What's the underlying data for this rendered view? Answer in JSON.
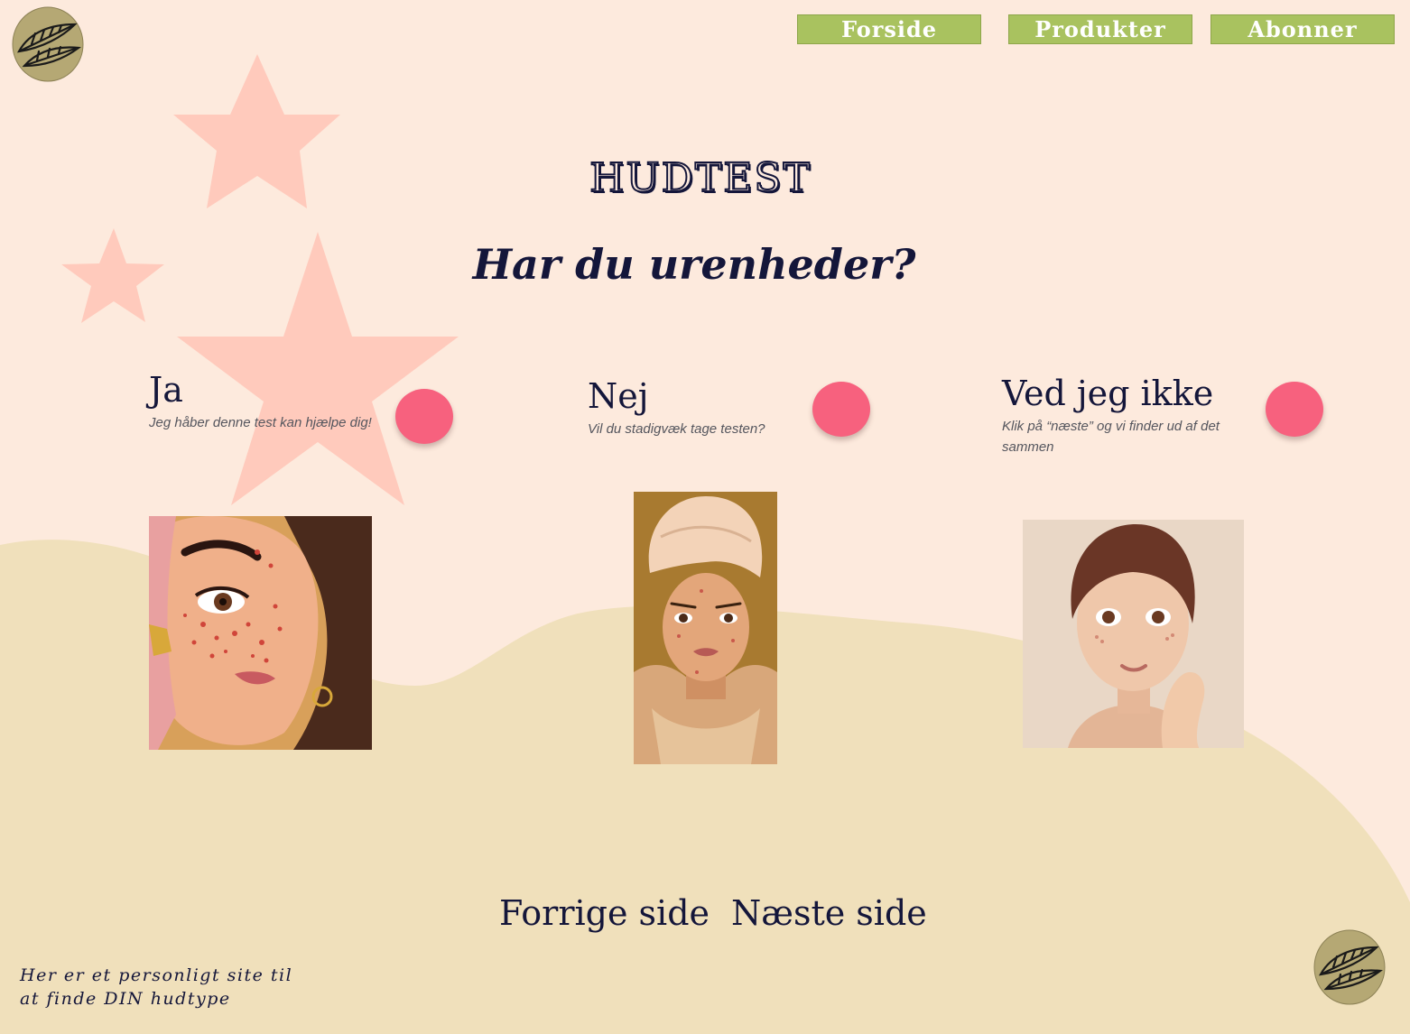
{
  "colors": {
    "background": "#fdeadd",
    "wave": "#f0e0bb",
    "star": "#ffcabc",
    "nav_button": "#a9c25f",
    "radio": "#f7617e",
    "text": "#14163a"
  },
  "nav": {
    "items": [
      "Forside",
      "Produkter",
      "Abonner"
    ]
  },
  "logo_icon": "feather-leaf-logo",
  "page_title": "HUDTEST",
  "question": "Har du urenheder?",
  "options": [
    {
      "title": "Ja",
      "subtitle": "Jeg håber denne test kan hjælpe dig!",
      "image": "woman-with-acne-mirror-illustration"
    },
    {
      "title": "Nej",
      "subtitle": "Vil du stadigvæk tage testen?",
      "image": "woman-in-towel-turban-illustration"
    },
    {
      "title": "Ved jeg ikke",
      "subtitle": "Klik på “næste” og vi finder ud af det sammen",
      "image": "woman-touching-face-illustration"
    }
  ],
  "pager": {
    "prev": "Forrige side",
    "next": "Næste side"
  },
  "footer_note": "Her er et personligt site til\nat finde DIN hudtype"
}
